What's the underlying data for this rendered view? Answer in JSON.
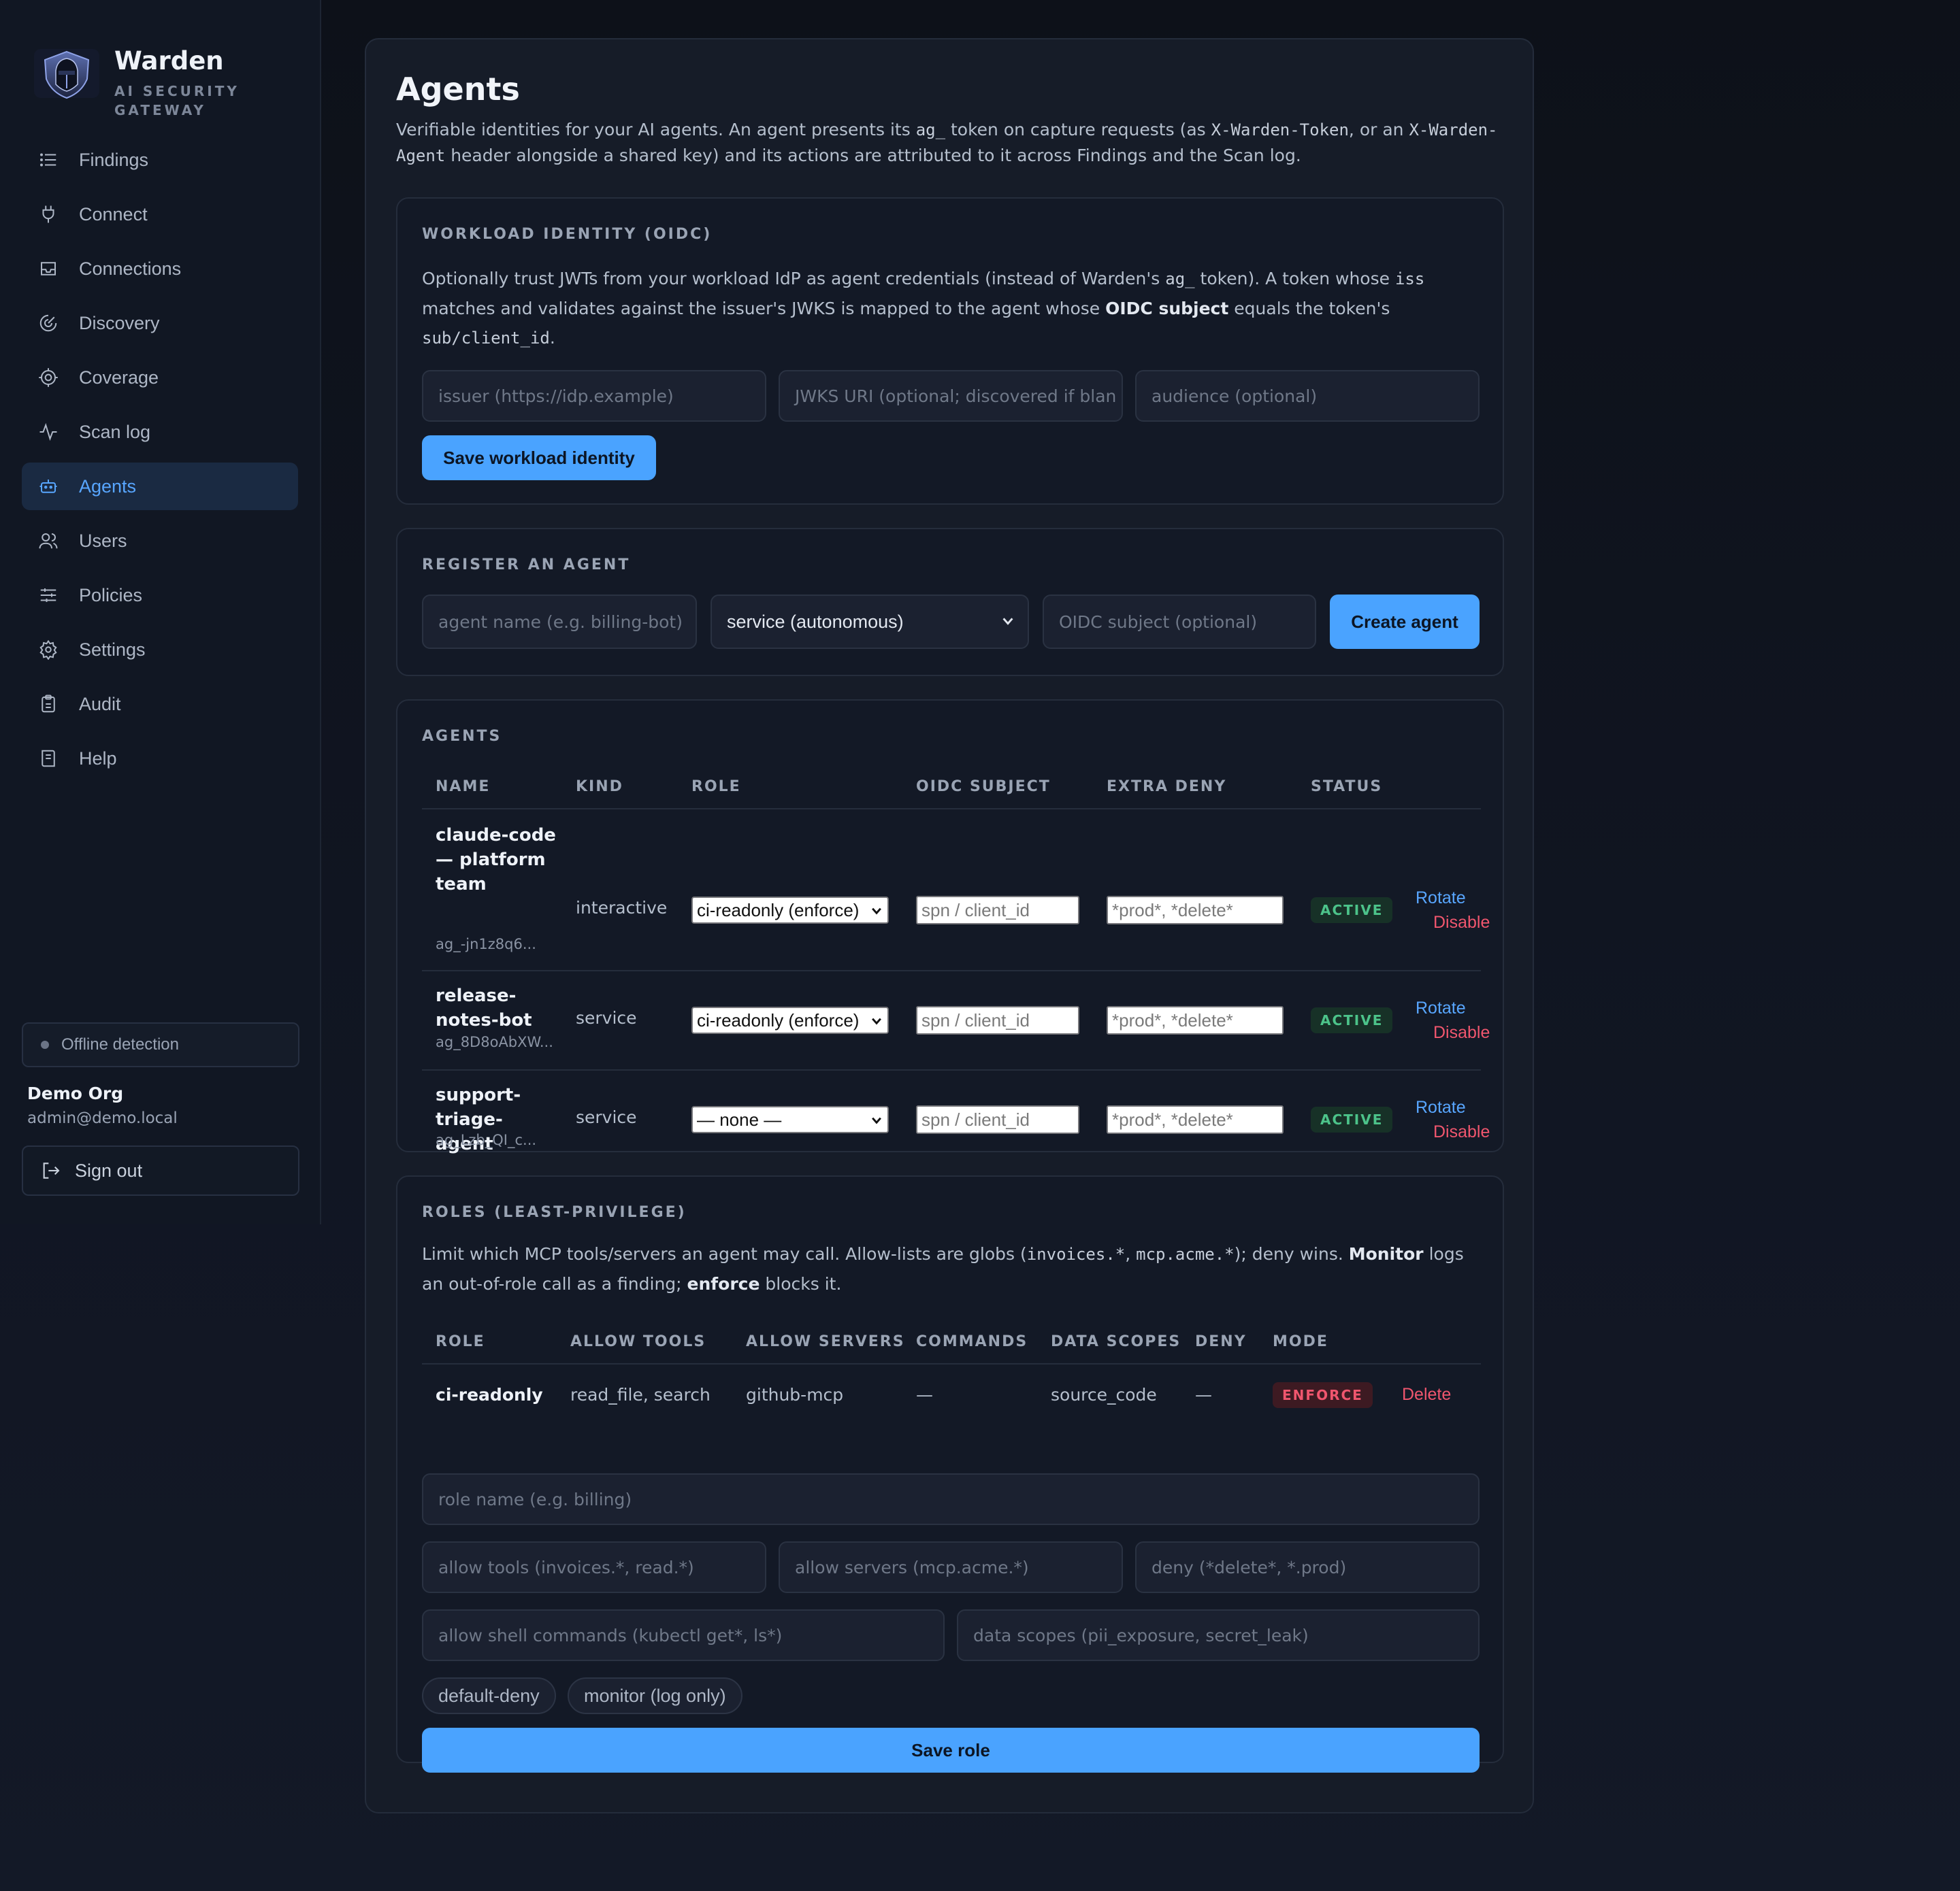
{
  "brand": {
    "name": "Warden",
    "subtitle_line1": "AI SECURITY",
    "subtitle_line2": "GATEWAY"
  },
  "nav": [
    {
      "label": "Findings",
      "icon": "list-icon"
    },
    {
      "label": "Connect",
      "icon": "plug-icon"
    },
    {
      "label": "Connections",
      "icon": "inbox-icon"
    },
    {
      "label": "Discovery",
      "icon": "radar-icon"
    },
    {
      "label": "Coverage",
      "icon": "target-icon"
    },
    {
      "label": "Scan log",
      "icon": "activity-icon"
    },
    {
      "label": "Agents",
      "icon": "bot-icon",
      "active": true
    },
    {
      "label": "Users",
      "icon": "users-icon"
    },
    {
      "label": "Policies",
      "icon": "sliders-icon"
    },
    {
      "label": "Settings",
      "icon": "gear-icon"
    },
    {
      "label": "Audit",
      "icon": "clipboard-icon"
    },
    {
      "label": "Help",
      "icon": "book-icon"
    }
  ],
  "status": {
    "offline_label": "Offline detection"
  },
  "org": {
    "name": "Demo Org",
    "email": "admin@demo.local"
  },
  "signout_label": "Sign out",
  "page": {
    "title": "Agents",
    "desc_1": "Verifiable identities for your AI agents. An agent presents its ",
    "desc_code_1": "ag_",
    "desc_2": " token on capture requests (as ",
    "desc_code_2": "X-Warden-Token",
    "desc_3": ", or an ",
    "desc_code_3": "X-Warden-Agent",
    "desc_4": " header alongside a shared key) and its actions are attributed to it across Findings and the Scan log."
  },
  "oidc": {
    "title": "WORKLOAD IDENTITY (OIDC)",
    "text_1": "Optionally trust JWTs from your workload IdP as agent credentials (instead of Warden's ",
    "text_code_1": "ag_",
    "text_2": " token). A token whose ",
    "text_code_2": "iss",
    "text_3": " matches and validates against the issuer's JWKS is mapped to the agent whose ",
    "text_bold": "OIDC subject",
    "text_4": " equals the token's ",
    "text_code_3": "sub/client_id",
    "text_5": ".",
    "issuer_placeholder": "issuer (https://idp.example)",
    "jwks_placeholder": "JWKS URI (optional; discovered if blan",
    "audience_placeholder": "audience (optional)",
    "save_label": "Save workload identity"
  },
  "register": {
    "title": "REGISTER AN AGENT",
    "name_placeholder": "agent name (e.g. billing-bot)",
    "kind_value": "service (autonomous)",
    "subject_placeholder": "OIDC subject (optional)",
    "create_label": "Create agent"
  },
  "agents": {
    "title": "AGENTS",
    "columns": [
      "NAME",
      "KIND",
      "ROLE",
      "OIDC SUBJECT",
      "EXTRA DENY",
      "STATUS"
    ],
    "rows": [
      {
        "name_l1": "claude-code",
        "name_l2": "— platform",
        "name_l3": "team",
        "id": "ag_-jn1z8q6...",
        "kind": "interactive",
        "role": "ci-readonly (enforce)",
        "subject_placeholder": "spn / client_id",
        "deny_placeholder": "*prod*, *delete*",
        "status": "ACTIVE",
        "rotate": "Rotate",
        "disable": "Disable"
      },
      {
        "name_l1": "release-",
        "name_l2": "notes-bot",
        "id": "ag_8D8oAbXW...",
        "kind": "service",
        "role": "ci-readonly (enforce)",
        "subject_placeholder": "spn / client_id",
        "deny_placeholder": "*prod*, *delete*",
        "status": "ACTIVE",
        "rotate": "Rotate",
        "disable": "Disable"
      },
      {
        "name_l1": "support-",
        "name_l2": "triage-agent",
        "id": "ag_Lzb_QI_c...",
        "kind": "service",
        "role": "— none —",
        "subject_placeholder": "spn / client_id",
        "deny_placeholder": "*prod*, *delete*",
        "status": "ACTIVE",
        "rotate": "Rotate",
        "disable": "Disable"
      }
    ]
  },
  "roles": {
    "title": "ROLES (LEAST-PRIVILEGE)",
    "text_1": "Limit which MCP tools/servers an agent may call. Allow-lists are globs (",
    "text_code_1": "invoices.*",
    "text_2": ", ",
    "text_code_2": "mcp.acme.*",
    "text_3": ");  deny wins. ",
    "text_bold_1": "Monitor",
    "text_4": " logs an out-of-role call as a finding; ",
    "text_bold_2": "enforce",
    "text_5": " blocks it.",
    "columns": [
      "ROLE",
      "ALLOW TOOLS",
      "ALLOW SERVERS",
      "COMMANDS",
      "DATA SCOPES",
      "DENY",
      "MODE"
    ],
    "rows": [
      {
        "role": "ci-readonly",
        "allow_tools": "read_file, search",
        "allow_servers": "github-mcp",
        "commands": "—",
        "data_scopes": "source_code",
        "deny": "—",
        "mode": "ENFORCE",
        "delete": "Delete"
      }
    ],
    "form": {
      "role_name_placeholder": "role name (e.g. billing)",
      "allow_tools_placeholder": "allow tools (invoices.*, read.*)",
      "allow_servers_placeholder": "allow servers (mcp.acme.*)",
      "deny_placeholder": "deny (*delete*, *.prod)",
      "commands_placeholder": "allow shell commands (kubectl get*, ls*)",
      "scopes_placeholder": "data scopes (pii_exposure, secret_leak)",
      "chip_default_deny": "default-deny",
      "chip_monitor": "monitor (log only)",
      "save_label": "Save role"
    }
  },
  "colors": {
    "accent": "#4aa3ff",
    "link": "#58a6ff",
    "danger": "#f0566e",
    "success": "#4cc38a",
    "background": "#0f141f"
  }
}
